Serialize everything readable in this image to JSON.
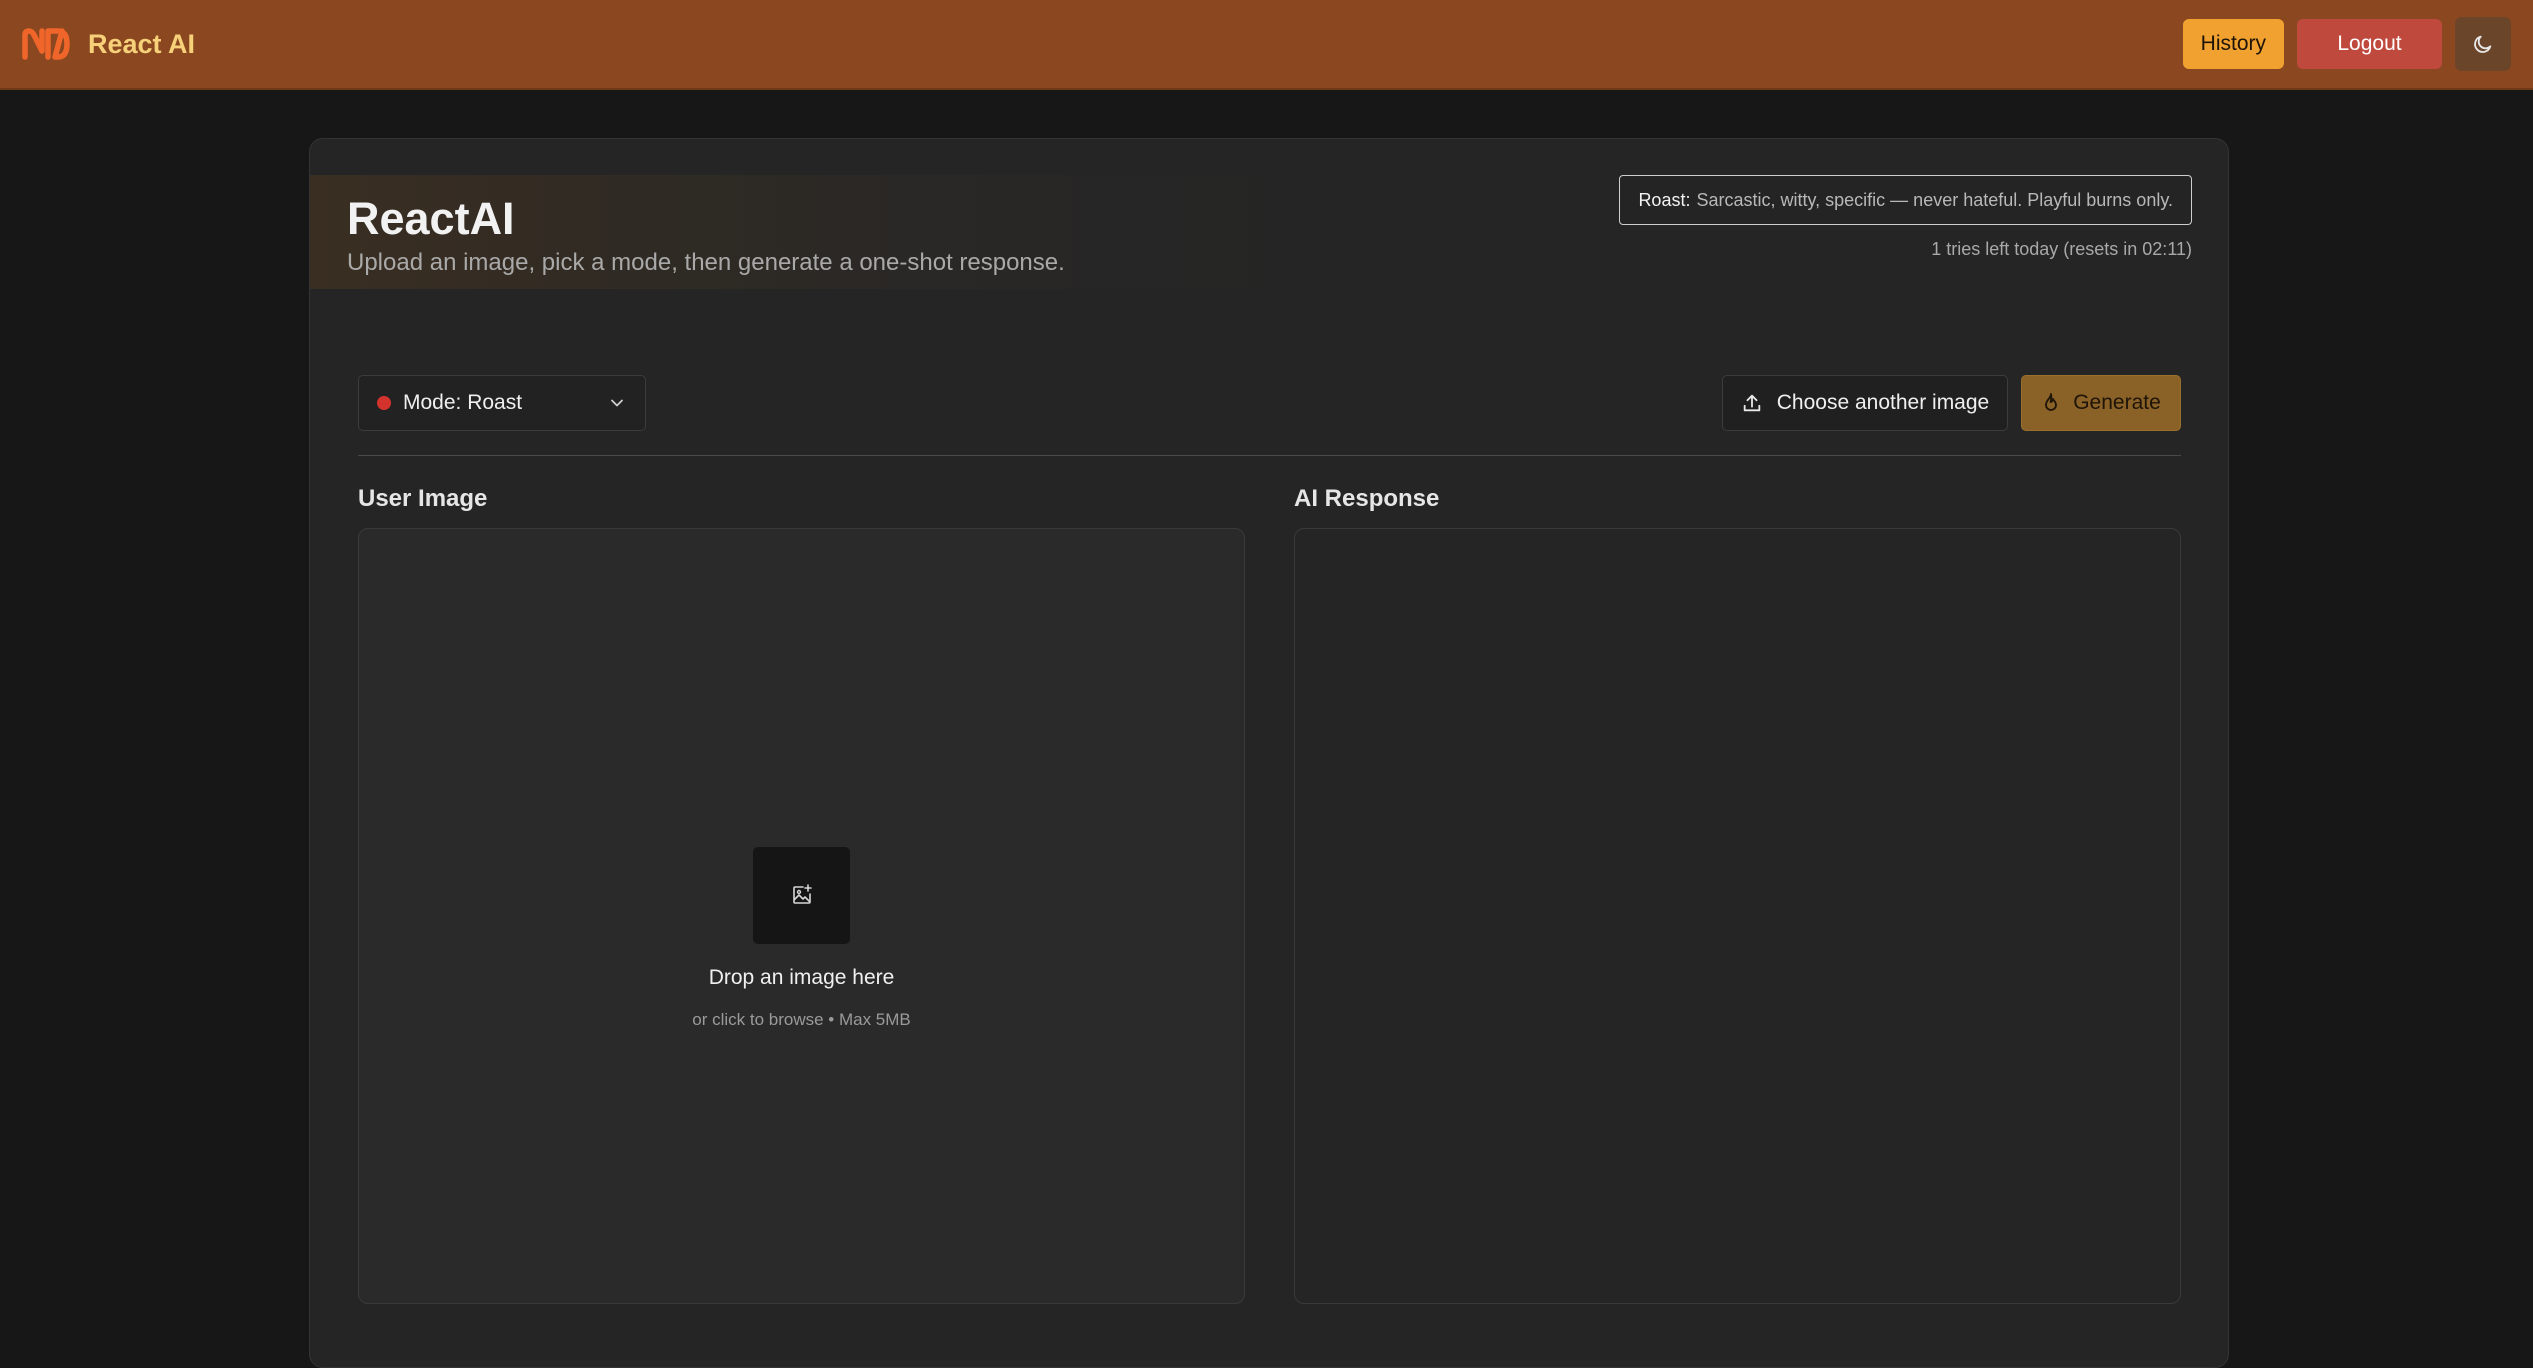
{
  "header": {
    "brand_name": "React AI",
    "history_label": "History",
    "logout_label": "Logout"
  },
  "hero": {
    "title": "ReactAI",
    "subtitle": "Upload an image, pick a mode, then generate a one-shot response."
  },
  "mode_note": {
    "label": "Roast:",
    "text": "Sarcastic, witty, specific — never hateful. Playful burns only."
  },
  "tries_text": "1 tries left today (resets in 02:11)",
  "toolbar": {
    "mode_label": "Mode: Roast",
    "choose_label": "Choose another image",
    "generate_label": "Generate"
  },
  "panels": {
    "user_title": "User Image",
    "ai_title": "AI Response"
  },
  "dropzone": {
    "title": "Drop an image here",
    "subtitle": "or click to browse • Max 5MB"
  },
  "colors": {
    "header_bg": "#8b4820",
    "brand_text": "#f6d17a",
    "history_btn": "#f0a12f",
    "logout_btn": "#c0493e",
    "generate_btn": "#8a6227",
    "mode_dot": "#d4322c",
    "page_bg": "#171717",
    "card_bg": "#252525"
  },
  "icons": {
    "logo": "nd-logo-icon",
    "theme": "moon-icon",
    "mode": "chevron-down-icon",
    "choose": "upload-icon",
    "generate": "flame-icon",
    "drop": "image-add-icon"
  }
}
